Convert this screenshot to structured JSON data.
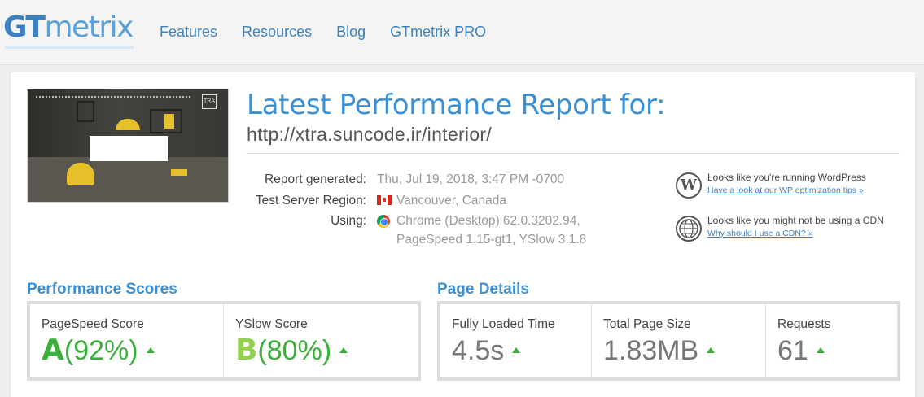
{
  "header": {
    "logo_gt": "GT",
    "logo_rest": "metrix",
    "nav": [
      "Features",
      "Resources",
      "Blog",
      "GTmetrix PRO"
    ]
  },
  "report": {
    "title": "Latest Performance Report for:",
    "url": "http://xtra.suncode.ir/interior/",
    "generated_label": "Report generated:",
    "generated_value": "Thu, Jul 19, 2018, 3:47 PM -0700",
    "region_label": "Test Server Region:",
    "region_value": "Vancouver, Canada",
    "using_label": "Using:",
    "using_value_1": "Chrome (Desktop) 62.0.3202.94,",
    "using_value_2": "PageSpeed 1.15-gt1, YSlow 3.1.8",
    "thumbnail_badge": "TRA"
  },
  "notes": [
    {
      "icon": "wordpress-icon",
      "text": "Looks like you're running WordPress",
      "link": "Have a look at our WP optimization tips »"
    },
    {
      "icon": "globe-icon",
      "text": "Looks like you might not be using a CDN",
      "link": "Why should I use a CDN? »"
    }
  ],
  "performance": {
    "title": "Performance Scores",
    "pagespeed_label": "PageSpeed Score",
    "pagespeed_grade": "A",
    "pagespeed_pct": "(92%)",
    "yslow_label": "YSlow Score",
    "yslow_grade": "B",
    "yslow_pct": "(80%)"
  },
  "details": {
    "title": "Page Details",
    "loaded_label": "Fully Loaded Time",
    "loaded_value": "4.5s",
    "size_label": "Total Page Size",
    "size_value": "1.83MB",
    "requests_label": "Requests",
    "requests_value": "61"
  },
  "colors": {
    "accent": "#3b8fd3",
    "grade_a": "#3cae3b",
    "grade_b": "#92d050"
  }
}
